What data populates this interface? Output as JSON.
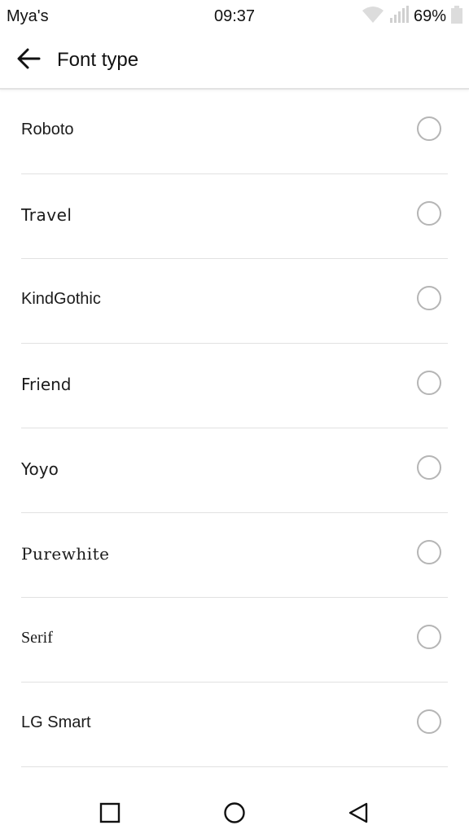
{
  "status_bar": {
    "carrier": "Mya's",
    "time": "09:37",
    "battery_percent": "69%",
    "icons": [
      "wifi-icon",
      "signal-icon",
      "battery-icon"
    ]
  },
  "app_bar": {
    "title": "Font type",
    "back_icon": "arrow-left-icon"
  },
  "fonts": [
    {
      "label": "Roboto",
      "selected": false
    },
    {
      "label": "Travel",
      "selected": false
    },
    {
      "label": "KindGothic",
      "selected": false
    },
    {
      "label": "Friend",
      "selected": false
    },
    {
      "label": "Yoyo",
      "selected": false
    },
    {
      "label": "Purewhite",
      "selected": false
    },
    {
      "label": "Serif",
      "selected": false
    },
    {
      "label": "LG Smart",
      "selected": false
    },
    {
      "label": "",
      "selected": true
    }
  ],
  "colors": {
    "accent": "#4fd6c4",
    "radio_border": "#b5b5b5",
    "divider": "#e1e1e1"
  },
  "nav_bar": {
    "icons": [
      "recent-apps-icon",
      "home-icon",
      "back-icon"
    ]
  }
}
